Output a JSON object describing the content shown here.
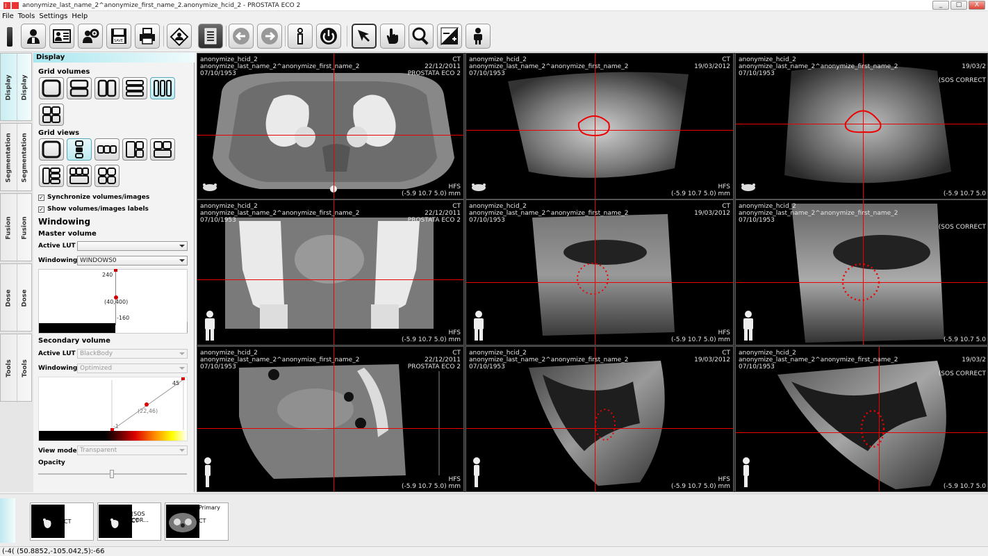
{
  "window": {
    "title": "anonymize_last_name_2^anonymize_first_name_2.anonymize_hcid_2 - PROSTATA ECO 2",
    "minimize": "_",
    "maximize": "□",
    "close": "X"
  },
  "menu": [
    "File",
    "Tools",
    "Settings",
    "Help"
  ],
  "toolbar": {
    "icons": [
      "patient-icon",
      "patient-list-icon",
      "patient-settings-icon",
      "save-icon",
      "print-icon",
      "home-icon",
      "notes-icon",
      "back-arrow-icon",
      "forward-arrow-icon",
      "info-icon",
      "power-icon",
      "pointer-icon",
      "hand-icon",
      "zoom-icon",
      "window-level-icon",
      "person-icon"
    ],
    "save_text": "SAVE"
  },
  "side_tabs": [
    {
      "label": "Display",
      "label2": "Display"
    },
    {
      "label": "Segmentation",
      "label2": "Segmentation"
    },
    {
      "label": "Fusion",
      "label2": "Fusion"
    },
    {
      "label": "Dose",
      "label2": "Dose"
    },
    {
      "label": "Tools",
      "label2": "Tools"
    }
  ],
  "panel": {
    "header": "Display",
    "grid_volumes_label": "Grid volumes",
    "grid_views_label": "Grid  views",
    "sync_label": "Synchronize volumes/images",
    "show_labels_label": "Show volumes/images labels",
    "windowing_title": "Windowing",
    "master_volume": "Master volume",
    "active_lut_label": "Active LUT",
    "active_lut_value": "",
    "windowing_label": "Windowing",
    "windowing_value": "WINDOWS0",
    "master_graph": {
      "top": "240",
      "mid": "(40,400)",
      "bottom": "-160"
    },
    "secondary_volume": "Secondary volume",
    "secondary_lut_value": "BlackBody",
    "secondary_windowing_value": "Optimized",
    "secondary_graph": {
      "top": "45",
      "mid": "(22,46)",
      "bottom": "-1"
    },
    "view_mode_label": "View mode",
    "view_mode_value": "Transparent",
    "opacity_label": "Opacity"
  },
  "viewports": [
    {
      "id": "ct-axial",
      "l1": "anonymize_hcid_2",
      "l2": "anonymize_last_name_2^anonymize_first_name_2",
      "l3": "07/10/1953",
      "r1": "CT",
      "r2": "22/12/2011",
      "r3": "PROSTATA ECO 2",
      "br1": "HFS",
      "br2": "(-5.9 10.7 5.0) mm"
    },
    {
      "id": "us1-axial",
      "l1": "anonymize_hcid_2",
      "l2": "anonymize_last_name_2^anonymize_first_name_2",
      "l3": "07/10/1953",
      "r1": "CT",
      "r2": "19/03/2012",
      "r3": "",
      "br1": "HFS",
      "br2": "(-5.9 10.7 5.0) mm"
    },
    {
      "id": "us2-axial",
      "l1": "anonymize_hcid_2",
      "l2": "anonymize_last_name_2^anonymize_first_name_2",
      "l3": "07/10/1953",
      "r1": "",
      "r2": "19/03/2",
      "r3": "(SOS CORRECT",
      "br1": "",
      "br2": "(-5.9 10.7 5.0"
    },
    {
      "id": "ct-coronal",
      "l1": "anonymize_hcid_2",
      "l2": "anonymize_last_name_2^anonymize_first_name_2",
      "l3": "07/10/1953",
      "r1": "CT",
      "r2": "22/12/2011",
      "r3": "PROSTATA ECO 2",
      "br1": "HFS",
      "br2": "(-5.9 10.7 5.0) mm"
    },
    {
      "id": "us1-coronal",
      "l1": "anonymize_hcid_2",
      "l2": "anonymize_last_name_2^anonymize_first_name_2",
      "l3": "07/10/1953",
      "r1": "CT",
      "r2": "19/03/2012",
      "r3": "",
      "br1": "HFS",
      "br2": "(-5.9 10.7 5.0) mm"
    },
    {
      "id": "us2-coronal",
      "l1": "anonymize_hcid_2",
      "l2": "anonymize_last_name_2^anonymize_first_name_2",
      "l3": "07/10/1953",
      "r1": "",
      "r2": "19/03/2",
      "r3": "(SOS CORRECT",
      "br1": "",
      "br2": "(-5.9 10.7 5.0"
    },
    {
      "id": "ct-sagittal",
      "l1": "anonymize_hcid_2",
      "l2": "anonymize_last_name_2^anonymize_first_name_2",
      "l3": "07/10/1953",
      "r1": "CT",
      "r2": "22/12/2011",
      "r3": "PROSTATA ECO 2",
      "br1": "HFS",
      "br2": "(-5.9 10.7 5.0) mm"
    },
    {
      "id": "us1-sagittal",
      "l1": "anonymize_hcid_2",
      "l2": "anonymize_last_name_2^anonymize_first_name_2",
      "l3": "07/10/1953",
      "r1": "CT",
      "r2": "19/03/2012",
      "r3": "",
      "br1": "HFS",
      "br2": "(-5.9 10.7 5.0) mm"
    },
    {
      "id": "us2-sagittal",
      "l1": "anonymize_hcid_2",
      "l2": "anonymize_last_name_2^anonymize_first_name_2",
      "l3": "07/10/1953",
      "r1": "",
      "r2": "19/03/2",
      "r3": "(SOS CORRECT",
      "br1": "",
      "br2": "(-5.9 10.7 5.0"
    }
  ],
  "thumbnails": [
    {
      "top": "",
      "label": "CT"
    },
    {
      "top": "(SOS COR...",
      "label": "CT"
    },
    {
      "top": "Primary",
      "label": "CT"
    }
  ],
  "status": "(-4( (50.8852,-105.042,5):-66"
}
